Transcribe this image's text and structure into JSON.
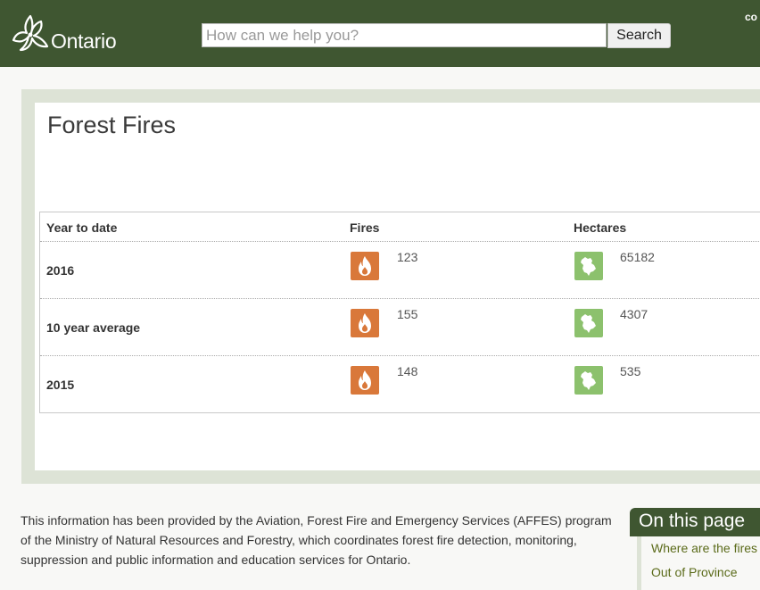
{
  "header": {
    "logo_text": "Ontario",
    "search_placeholder": "How can we help you?",
    "search_button": "Search",
    "language_link": "co"
  },
  "page": {
    "title": "Forest Fires"
  },
  "table": {
    "columns": [
      "Year to date",
      "Fires",
      "Hectares"
    ],
    "rows": [
      {
        "label": "2016",
        "fires": "123",
        "hectares": "65182"
      },
      {
        "label": "10 year average",
        "fires": "155",
        "hectares": "4307"
      },
      {
        "label": "2015",
        "fires": "148",
        "hectares": "535"
      }
    ],
    "icons": {
      "fires": "flame-icon",
      "hectares": "ontario-map-icon"
    },
    "colors": {
      "fires_icon": "#d9783a",
      "hectares_icon": "#8cc16d"
    }
  },
  "info": {
    "text": "This information has been provided by the Aviation, Forest Fire and Emergency Services (AFFES) program of the Ministry of Natural Resources and Forestry, which coordinates forest fire detection, monitoring, suppression and public information and education services for Ontario."
  },
  "on_this_page": {
    "title": "On this page",
    "items": [
      "Where are the fires",
      "Out of Province"
    ]
  },
  "colors": {
    "header_bg": "#3f5631",
    "panel_bg": "#dde3d6",
    "link": "#5b6b1a"
  }
}
